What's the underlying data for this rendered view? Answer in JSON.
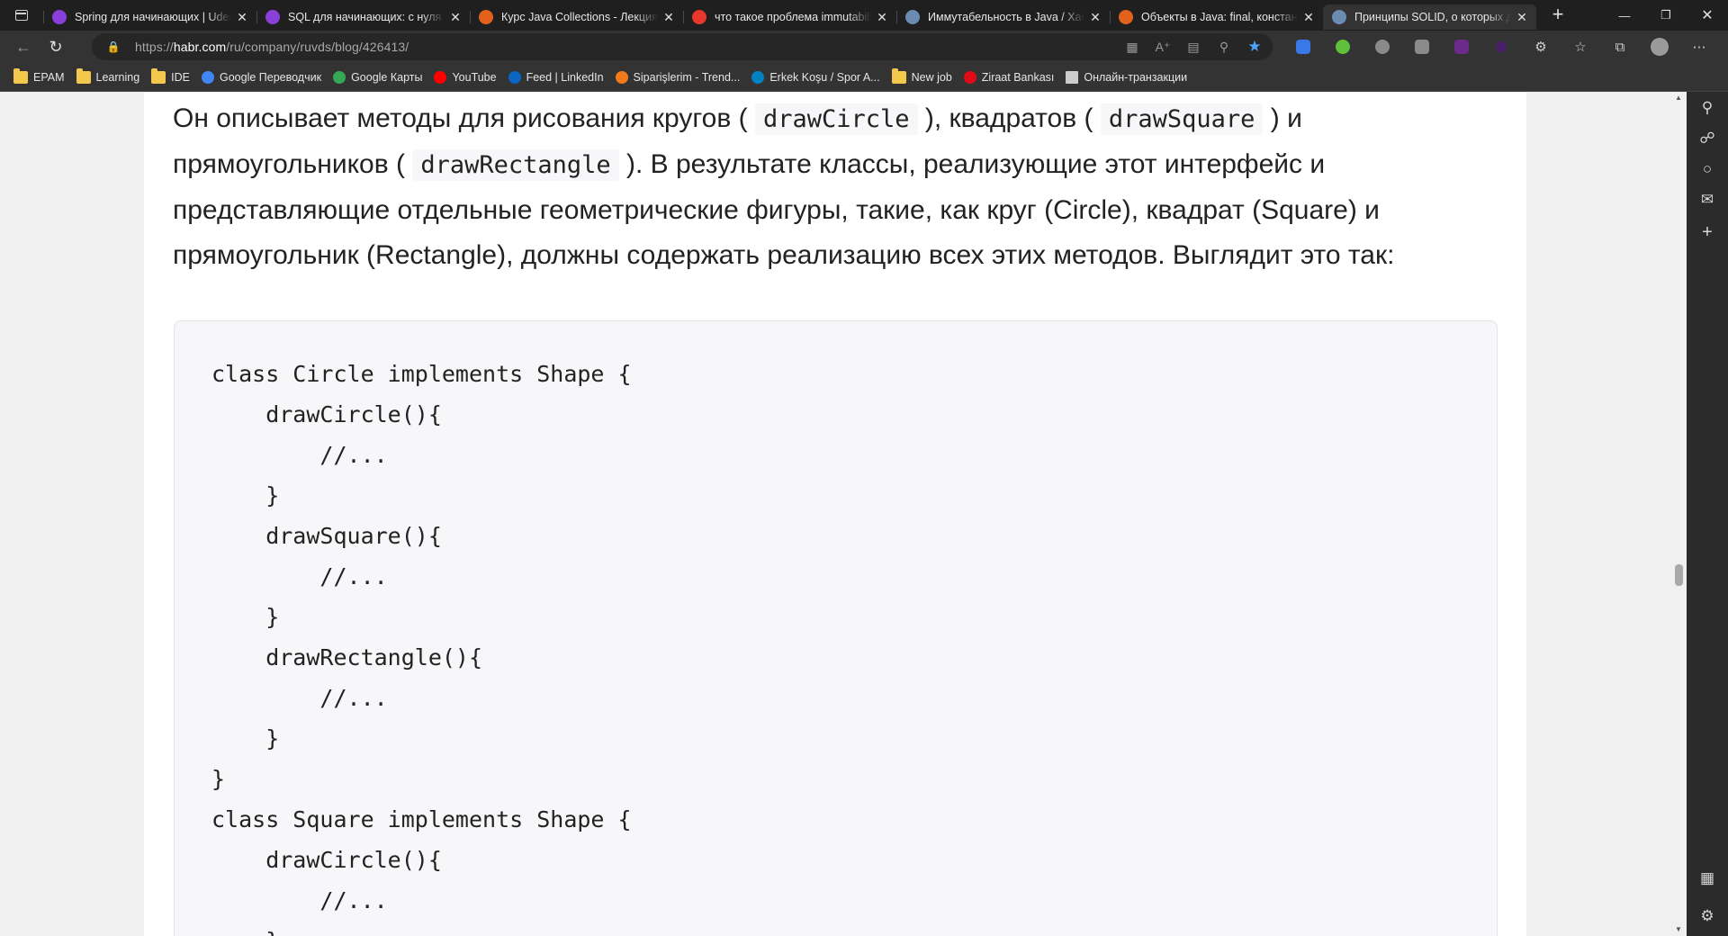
{
  "tabs": [
    {
      "title": "Spring для начинающих | Udemy",
      "favicon_color": "#8b3fd9",
      "favicon_letter": "U",
      "active": false
    },
    {
      "title": "SQL для начинающих: с нуля до сертификата",
      "favicon_color": "#8b3fd9",
      "favicon_letter": "U",
      "active": false
    },
    {
      "title": "Курс Java Collections - Лекция: ",
      "favicon_color": "#e2621b",
      "favicon_letter": "!",
      "active": false
    },
    {
      "title": "что такое проблема immutability",
      "favicon_color": "#e8382d",
      "favicon_letter": "Я",
      "active": false
    },
    {
      "title": "Иммутабельность в Java / Хабр",
      "favicon_color": "#6b8bb3",
      "favicon_letter": "Х",
      "active": false
    },
    {
      "title": "Объекты в Java: final, константы",
      "favicon_color": "#e2621b",
      "favicon_letter": "!",
      "active": false
    },
    {
      "title": "Принципы SOLID, о которых должен знать",
      "favicon_color": "#6b8bb3",
      "favicon_letter": "Х",
      "active": true
    }
  ],
  "address": {
    "url_prefix": "https://",
    "url_host": "habr.com",
    "url_path": "/ru/company/ruvds/blog/426413/"
  },
  "bookmarks": [
    {
      "label": "EPAM",
      "icon": "folder-icon",
      "color": "#f2c94c"
    },
    {
      "label": "Learning",
      "icon": "folder-icon",
      "color": "#f2c94c"
    },
    {
      "label": "IDE",
      "icon": "folder-icon",
      "color": "#f2c94c"
    },
    {
      "label": "Google Переводчик",
      "icon": "google-translate-icon",
      "color": "#4285f4"
    },
    {
      "label": "Google Карты",
      "icon": "google-maps-icon",
      "color": "#34a853"
    },
    {
      "label": "YouTube",
      "icon": "youtube-icon",
      "color": "#ff0000"
    },
    {
      "label": "Feed | LinkedIn",
      "icon": "linkedin-icon",
      "color": "#0a66c2"
    },
    {
      "label": "Siparişlerim - Trend...",
      "icon": "trendyol-icon",
      "color": "#f27a1a"
    },
    {
      "label": "Erkek Koşu / Spor A...",
      "icon": "decathlon-icon",
      "color": "#0082c3"
    },
    {
      "label": "New job",
      "icon": "folder-icon",
      "color": "#f2c94c"
    },
    {
      "label": "Ziraat Bankası",
      "icon": "ziraat-icon",
      "color": "#e30a17"
    },
    {
      "label": "Онлайн-транзакции",
      "icon": "page-icon",
      "color": "#cccccc"
    }
  ],
  "article": {
    "para_1": "Он описывает методы для рисования кругов ( ",
    "code_1": "drawCircle",
    "para_2": " ), квадратов ( ",
    "code_2": "drawSquare",
    "para_3": " ) и прямоугольников ( ",
    "code_3": "drawRectangle",
    "para_4": " ). В результате классы, реализующие этот интерфейс и представляющие отдельные геометрические фигуры, такие, как круг (Circle), квадрат (Square) и прямоугольник (Rectangle), должны содержать реализацию всех этих методов. Выглядит это так:"
  },
  "code_lines": [
    "class Circle implements Shape {",
    "    drawCircle(){",
    "        //...",
    "    }",
    "    drawSquare(){",
    "        //...",
    "    }",
    "    drawRectangle(){",
    "        //...",
    "    }",
    "}",
    "class Square implements Shape {",
    "    drawCircle(){",
    "        //...",
    "    }"
  ]
}
